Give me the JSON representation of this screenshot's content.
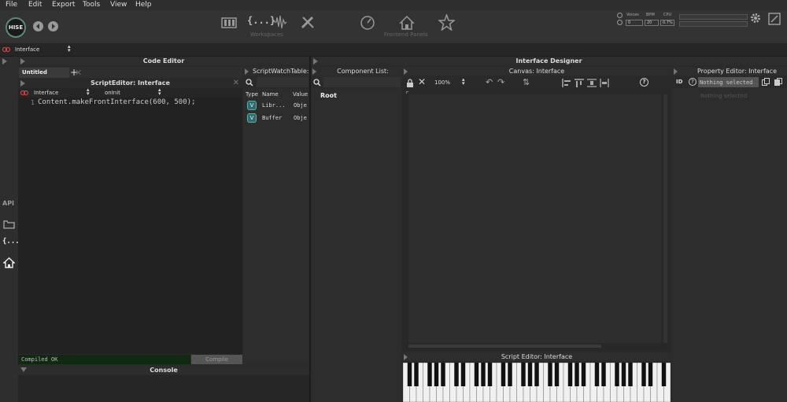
{
  "menu": {
    "file": "File",
    "edit": "Edit",
    "export": "Export",
    "tools": "Tools",
    "view": "View",
    "help": "Help"
  },
  "logo": "HISE",
  "toolbar": {
    "workspaces": "Workspaces",
    "frontend_panels": "Frontend Panels",
    "workspace_glyph": "{...}"
  },
  "stats": {
    "voices_label": "Voices",
    "bpm_label": "BPM",
    "cpu_label": "CPU",
    "voices": "0",
    "bpm": "20",
    "cpu": "0.7%"
  },
  "strip": {
    "selector": "Interface"
  },
  "code_editor": {
    "title": "Code Editor",
    "tab": "Untitled",
    "script_editor_title": "ScriptEditor: Interface",
    "processor": "Interface",
    "callback": "onInit",
    "line_number": "1",
    "code": "Content.makeFrontInterface(600, 500);",
    "status": "Compiled OK",
    "compile_button": "Compile"
  },
  "watch": {
    "title": "ScriptWatchTable:...",
    "col_type": "Type",
    "col_name": "Name",
    "col_value": "Value",
    "rows": [
      {
        "type": "V",
        "name": "Libr...",
        "value": "Obje"
      },
      {
        "type": "V",
        "name": "Buffer",
        "value": "Obje"
      }
    ]
  },
  "console": {
    "title": "Console"
  },
  "sidebar": {
    "api": "API",
    "code_glyph": "{...}"
  },
  "interface_designer": {
    "title": "Interface Designer"
  },
  "component_list": {
    "title": "Component List: Interface",
    "root": "Root"
  },
  "canvas": {
    "title": "Canvas: Interface",
    "zoom": "100%",
    "help": "?"
  },
  "property_editor": {
    "title": "Property Editor: Interface",
    "id_label": "ID",
    "id_value": "Nothing selected",
    "placeholder": "Nothing selected"
  },
  "bottom_script_editor": {
    "title": "Script Editor: Interface"
  },
  "colors": {
    "accent": "#4fb4a0",
    "ok_bg": "#0f2a10",
    "bg": "#2a2a2a"
  }
}
